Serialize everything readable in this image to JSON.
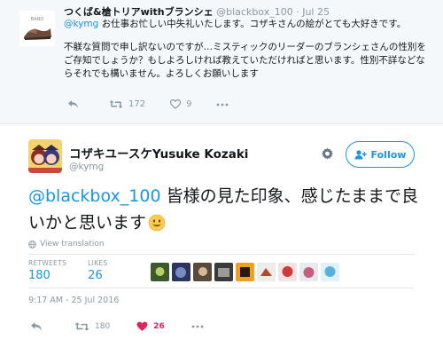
{
  "parent_tweet": {
    "name": "つくば&槍トリアwithブランシェ",
    "handle": "@blackbox_100",
    "dot": "·",
    "date": "Jul 25",
    "mention": "@kymg",
    "text_line1": " お仕事お忙しい中失礼いたします。コザキさんの絵がとても大好きです。",
    "text_para2": "不躾な質問で申し訳ないのですが…ミスティックのリーダーのブランシェさんの性別をご存知でしょうか？もしよろしければ教えていただければと思います。性別不詳などならそれでも構いません。よろしくお願いします",
    "actions": {
      "reply_icon": "reply-icon",
      "retweet_icon": "retweet-icon",
      "retweet_count": "172",
      "like_icon": "heart-icon",
      "like_count": "9",
      "more_icon": "more-icon"
    }
  },
  "main_tweet": {
    "name": "コザキユースケYusuke Kozaki",
    "handle": "@kymg",
    "follow_label": "Follow",
    "mention": "@blackbox_100",
    "text": " 皆様の見た印象、感じたままで良いかと思います",
    "emoji": "smiling-face-emoji",
    "translate_label": "View translation",
    "retweets_label": "RETWEETS",
    "retweets_count": "180",
    "likes_label": "LIKES",
    "likes_count": "26",
    "timestamp": "9:17 AM - 25 Jul 2016",
    "actions": {
      "retweet_count": "180",
      "like_count": "26"
    }
  },
  "colors": {
    "link": "#1b95e0",
    "muted": "#8899a6",
    "liked": "#e0245e",
    "parent_bg": "#f5f8fa"
  }
}
